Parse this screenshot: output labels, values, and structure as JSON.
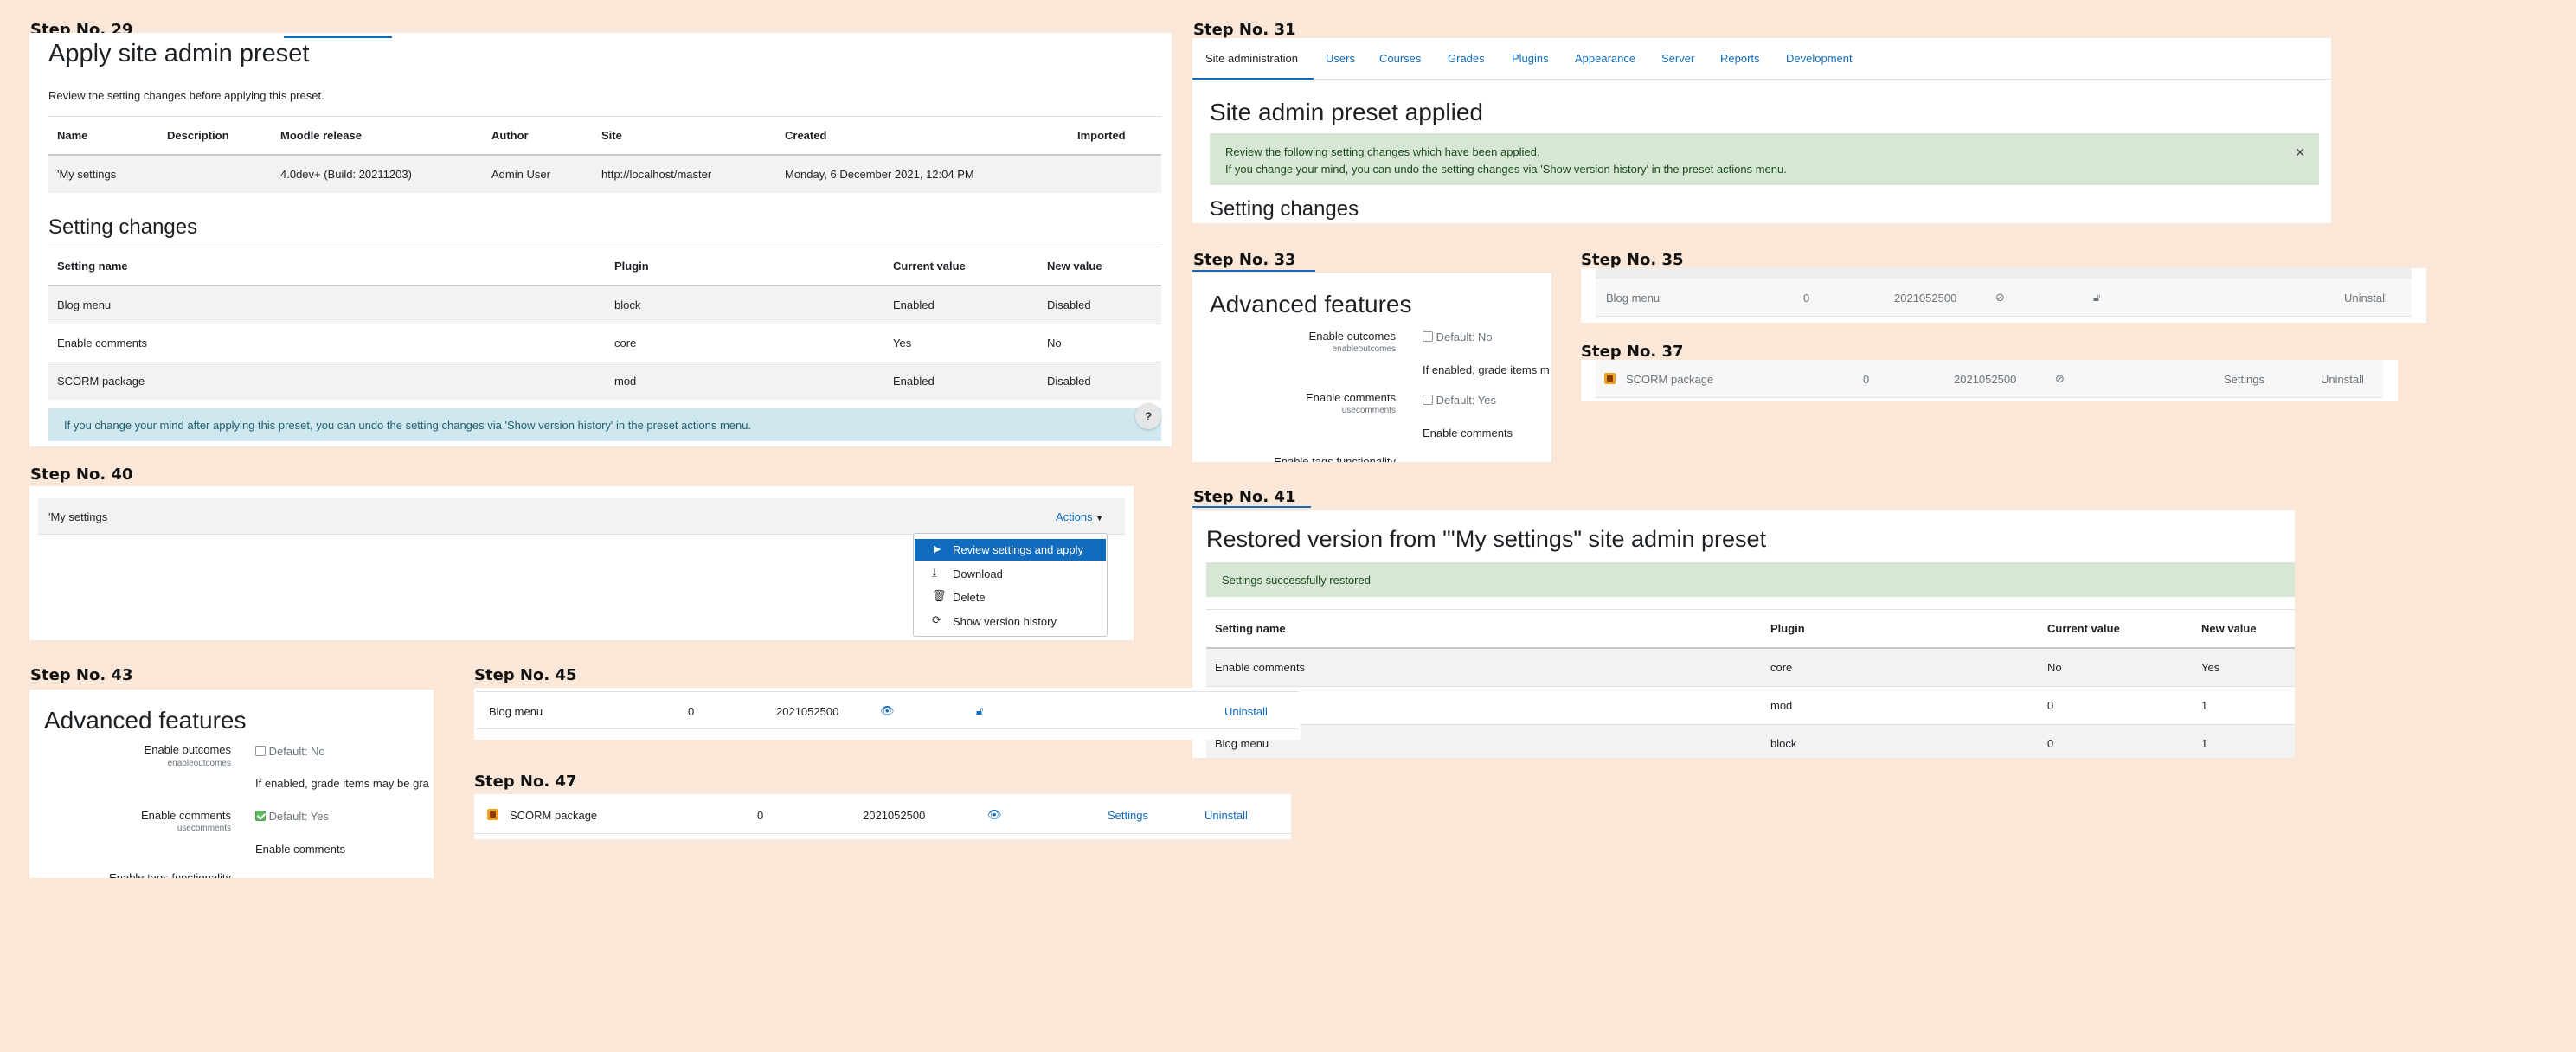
{
  "steps": {
    "s29": "Step No.  29",
    "s31": "Step No.  31",
    "s33": "Step No.  33",
    "s35": "Step No.  35",
    "s37": "Step No.  37",
    "s40": "Step No.  40",
    "s41": "Step No.  41",
    "s43": "Step No.  43",
    "s45": "Step No.  45",
    "s47": "Step No.  47"
  },
  "apply_preset": {
    "title": "Apply site admin preset",
    "intro": "Review the setting changes before applying this preset.",
    "preset_headers": [
      "Name",
      "Description",
      "Moodle release",
      "Author",
      "Site",
      "Created",
      "Imported"
    ],
    "preset_row": [
      "'My settings",
      "",
      "4.0dev+ (Build: 20211203)",
      "Admin User",
      "http://localhost/master",
      "Monday, 6 December 2021, 12:04 PM",
      ""
    ],
    "changes_title": "Setting changes",
    "changes_headers": [
      "Setting name",
      "Plugin",
      "Current value",
      "New value"
    ],
    "changes_rows": [
      [
        "Blog menu",
        "block",
        "Enabled",
        "Disabled"
      ],
      [
        "Enable comments",
        "core",
        "Yes",
        "No"
      ],
      [
        "SCORM package",
        "mod",
        "Enabled",
        "Disabled"
      ]
    ],
    "info_alert": "If you change your mind after applying this preset, you can undo the setting changes via 'Show version history' in the preset actions menu.",
    "help_label": "?"
  },
  "applied": {
    "tabs": [
      "Site administration",
      "Users",
      "Courses",
      "Grades",
      "Plugins",
      "Appearance",
      "Server",
      "Reports",
      "Development"
    ],
    "title": "Site admin preset applied",
    "alert_line1": "Review the following setting changes which have been applied.",
    "alert_line2": "If you change your mind, you can undo the setting changes via 'Show version history' in the preset actions menu.",
    "close": "✕",
    "subtitle": "Setting changes"
  },
  "advanced_a": {
    "title": "Advanced features",
    "outcomes_label": "Enable outcomes",
    "outcomes_key": "enableoutcomes",
    "outcomes_default": "Default: No",
    "outcomes_desc": "If enabled, grade items m",
    "comments_label": "Enable comments",
    "comments_key": "usecomments",
    "comments_default": "Default: Yes",
    "comments_desc": "Enable comments",
    "tags_label": "Enable tags functionality"
  },
  "plugin35": {
    "name": "Blog menu",
    "count": "0",
    "version": "2021052500",
    "uninstall": "Uninstall"
  },
  "plugin37": {
    "name": "SCORM package",
    "count": "0",
    "version": "2021052500",
    "settings": "Settings",
    "uninstall": "Uninstall"
  },
  "preset_list": {
    "name": "'My settings",
    "actions": "Actions",
    "menu": [
      "Review settings and apply",
      "Download",
      "Delete",
      "Show version history"
    ]
  },
  "restored": {
    "title": "Restored version from \"'My settings\" site admin preset",
    "success": "Settings successfully restored",
    "headers": [
      "Setting name",
      "Plugin",
      "Current value",
      "New value"
    ],
    "rows": [
      [
        "Enable comments",
        "core",
        "No",
        "Yes"
      ],
      [
        "",
        "mod",
        "0",
        "1"
      ],
      [
        "Blog menu",
        "block",
        "0",
        "1"
      ]
    ]
  },
  "advanced_b": {
    "title": "Advanced features",
    "outcomes_label": "Enable outcomes",
    "outcomes_key": "enableoutcomes",
    "outcomes_default": "Default: No",
    "outcomes_desc": "If enabled, grade items may be gra",
    "comments_label": "Enable comments",
    "comments_key": "usecomments",
    "comments_default": "Default: Yes",
    "comments_desc": "Enable comments",
    "tags_label": "Enable tags functionality"
  },
  "plugin45": {
    "name": "Blog menu",
    "count": "0",
    "version": "2021052500",
    "uninstall": "Uninstall"
  },
  "plugin47": {
    "name": "SCORM package",
    "count": "0",
    "version": "2021052500",
    "settings": "Settings",
    "uninstall": "Uninstall"
  }
}
